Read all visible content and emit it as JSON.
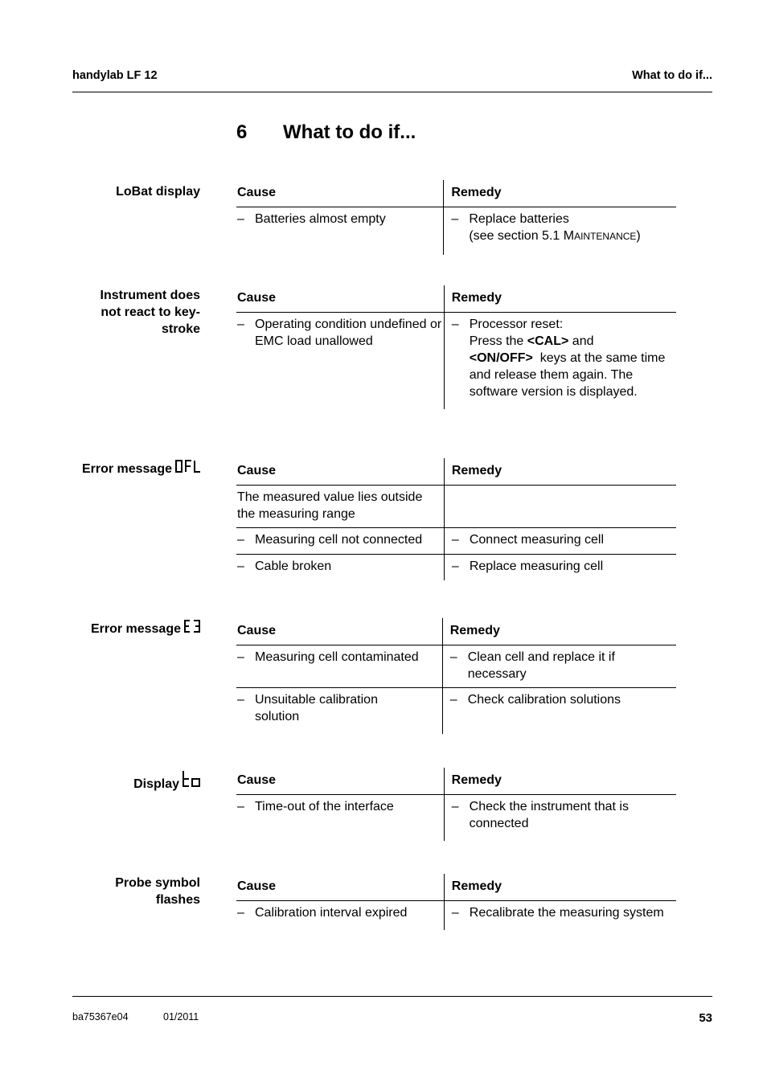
{
  "header": {
    "product": "handylab LF 12",
    "section_title": "What to do if..."
  },
  "chapter": {
    "number": "6",
    "title": "What to do if..."
  },
  "table_headers": {
    "cause": "Cause",
    "remedy": "Remedy"
  },
  "sections": [
    {
      "label": "LoBat display",
      "rows": [
        {
          "cause": "Batteries almost empty",
          "remedy_line1": "Replace batteries",
          "remedy_line2_prefix": "(see section 5.1 M",
          "remedy_line2_smallcaps": "AINTENANCE",
          "remedy_line2_suffix": ")"
        }
      ]
    },
    {
      "label_lines": [
        "Instrument does",
        "not react to key-",
        "stroke"
      ],
      "rows": [
        {
          "cause": "Operating condition undefined or EMC load unallowed",
          "remedy_parts": {
            "line1": "Processor reset:",
            "press": "Press the ",
            "key1": "<CAL>",
            "and": " and",
            "key2": "<ON/OFF>",
            "rest": "  keys at the same time and release them again. The software version is displayed."
          }
        }
      ]
    },
    {
      "label": "Error message",
      "display_code": "OFL",
      "rows": [
        {
          "cause_plain": "The measured value lies outside the measuring range",
          "remedy": ""
        },
        {
          "cause": "Measuring cell not connected",
          "remedy": "Connect measuring cell"
        },
        {
          "cause": "Cable broken",
          "remedy": "Replace measuring cell"
        }
      ]
    },
    {
      "label": "Error message",
      "display_code": "E3",
      "rows": [
        {
          "cause": "Measuring cell contaminated",
          "remedy": "Clean cell and replace it if necessary"
        },
        {
          "cause": "Unsuitable calibration solution",
          "remedy": "Check calibration solutions"
        }
      ]
    },
    {
      "label": "Display",
      "display_code": "to",
      "rows": [
        {
          "cause": "Time-out of the interface",
          "remedy": "Check the instrument that is connected"
        }
      ]
    },
    {
      "label_lines": [
        "Probe symbol",
        "flashes"
      ],
      "rows": [
        {
          "cause": "Calibration interval expired",
          "remedy": "Recalibrate the measuring system"
        }
      ]
    }
  ],
  "dash": "–",
  "footer": {
    "doc_id": "ba75367e04",
    "date": "01/2011",
    "page_number": "53"
  }
}
